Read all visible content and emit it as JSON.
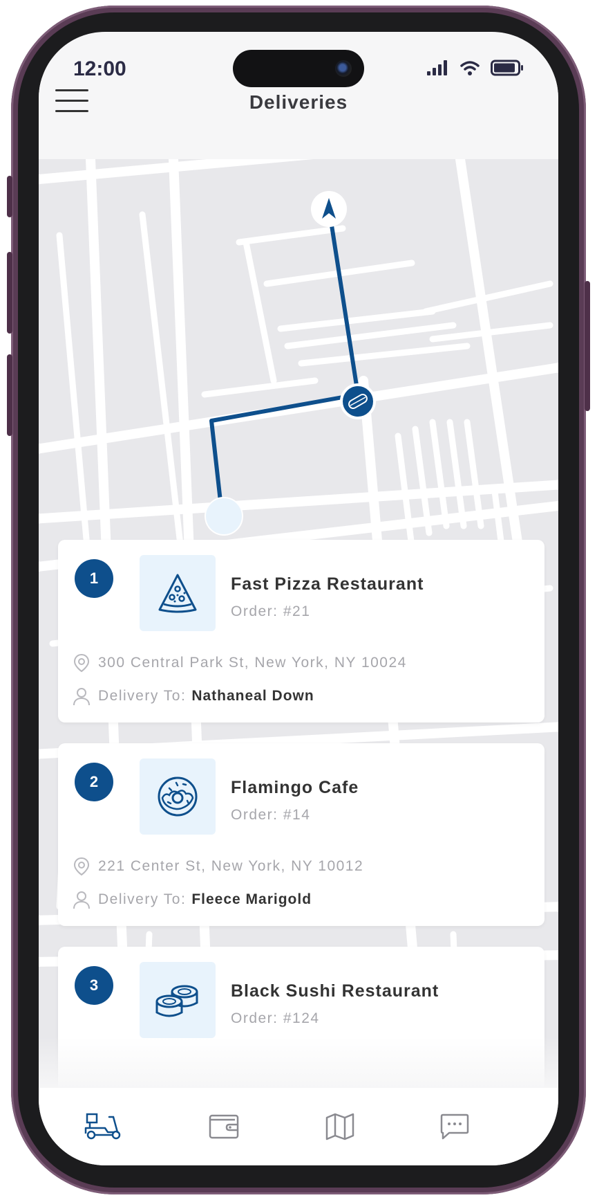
{
  "status_bar": {
    "time": "12:00"
  },
  "header": {
    "title": "Deliveries"
  },
  "map": {
    "map_icon": "map-view",
    "driver_marker_icon": "navigation-arrow-icon",
    "pickup_marker_icon": "hotdog-icon"
  },
  "deliveries": [
    {
      "number": "1",
      "restaurant": "Fast Pizza Restaurant",
      "order": "Order: #21",
      "address": "300 Central Park St, New York, NY 10024",
      "delivery_label": "Delivery To:",
      "customer": "Nathaneal Down",
      "icon": "pizza-icon"
    },
    {
      "number": "2",
      "restaurant": "Flamingo Cafe",
      "order": "Order: #14",
      "address": "221 Center St, New York, NY 10012",
      "delivery_label": "Delivery To:",
      "customer": "Fleece Marigold",
      "icon": "donut-icon"
    },
    {
      "number": "3",
      "restaurant": "Black Sushi Restaurant",
      "order": "Order: #124",
      "icon": "sushi-icon"
    }
  ],
  "tabbar": {
    "tabs": [
      "scooter-icon",
      "wallet-icon",
      "map-icon",
      "chat-icon"
    ],
    "active": "scooter-icon"
  },
  "colors": {
    "accent": "#0e4f8c",
    "accent_light": "#e8f3fc",
    "map_bg": "#e8e8eb"
  }
}
